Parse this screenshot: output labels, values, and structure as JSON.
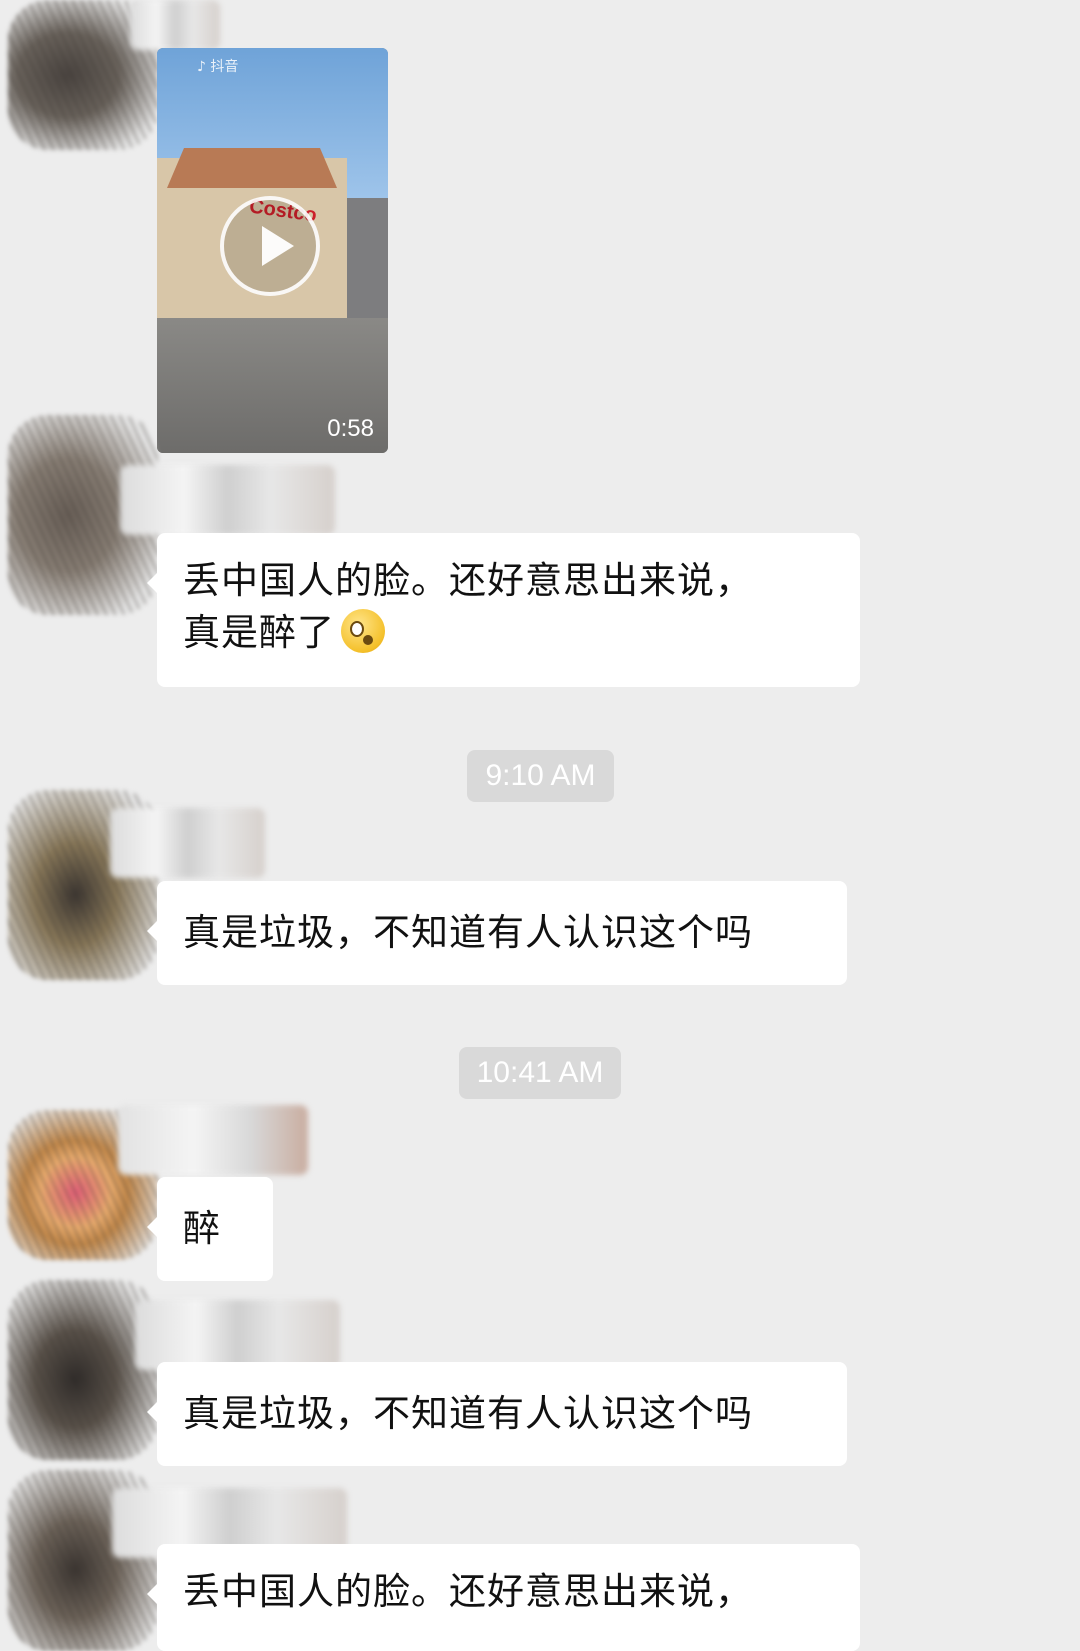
{
  "video_message": {
    "watermark": "♪ 抖音",
    "duration": "0:58",
    "store_sign": "Costco"
  },
  "timestamps": [
    {
      "label": "9:10 AM"
    },
    {
      "label": "10:41 AM"
    }
  ],
  "messages": [
    {
      "lines": [
        "丢中国人的脸。还好意思出来说，",
        "真是醉了"
      ],
      "emoji": "flushed-face-emoji"
    },
    {
      "lines": [
        "真是垃圾，不知道有人认识这个吗"
      ]
    },
    {
      "lines": [
        "醉"
      ]
    },
    {
      "lines": [
        "真是垃圾，不知道有人认识这个吗"
      ]
    },
    {
      "lines": [
        "丢中国人的脸。还好意思出来说，"
      ]
    }
  ],
  "colors": {
    "chat_background": "#ededed",
    "bubble_background": "#ffffff",
    "timestamp_pill": "#d9d9d9"
  }
}
